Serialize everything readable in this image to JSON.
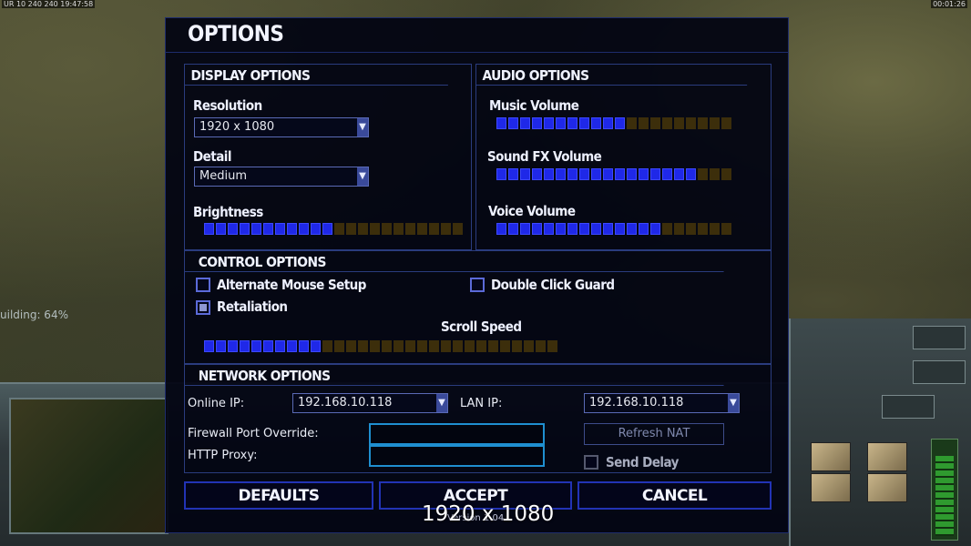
{
  "hud": {
    "top_left": "UR 10 240 240 19:47:58",
    "top_right": "00:01:26",
    "building_status": "uilding: 64%"
  },
  "dialog": {
    "title": "OPTIONS",
    "display": {
      "heading": "DISPLAY OPTIONS",
      "resolution_label": "Resolution",
      "resolution_value": "1920 x 1080",
      "detail_label": "Detail",
      "detail_value": "Medium",
      "brightness_label": "Brightness",
      "brightness_level": 0.5
    },
    "audio": {
      "heading": "AUDIO OPTIONS",
      "music_label": "Music Volume",
      "music_level": 0.57,
      "sfx_label": "Sound FX Volume",
      "sfx_level": 0.86,
      "voice_label": "Voice Volume",
      "voice_level": 0.71
    },
    "control": {
      "heading": "CONTROL OPTIONS",
      "alternate_mouse_label": "Alternate Mouse Setup",
      "alternate_mouse_checked": false,
      "double_click_label": "Double Click Guard",
      "double_click_checked": false,
      "retaliation_label": "Retaliation",
      "retaliation_checked": true,
      "scroll_speed_label": "Scroll Speed",
      "scroll_speed_level": 0.32
    },
    "network": {
      "heading": "NETWORK OPTIONS",
      "online_ip_label": "Online IP:",
      "online_ip_value": "192.168.10.118",
      "lan_ip_label": "LAN IP:",
      "lan_ip_value": "192.168.10.118",
      "firewall_label": "Firewall Port Override:",
      "firewall_value": "",
      "proxy_label": "HTTP Proxy:",
      "proxy_value": "",
      "refresh_nat_label": "Refresh NAT",
      "send_delay_label": "Send Delay",
      "send_delay_checked": false
    },
    "buttons": {
      "defaults": "DEFAULTS",
      "accept": "ACCEPT",
      "cancel": "CANCEL"
    },
    "version": "Version 1.04"
  },
  "overlay_resolution": "1920 x 1080",
  "colors": {
    "accent": "#1f28e8",
    "slider_off": "#3c2e0b",
    "panel_border": "#2a3c7e",
    "input_border": "#1f8fd0"
  }
}
